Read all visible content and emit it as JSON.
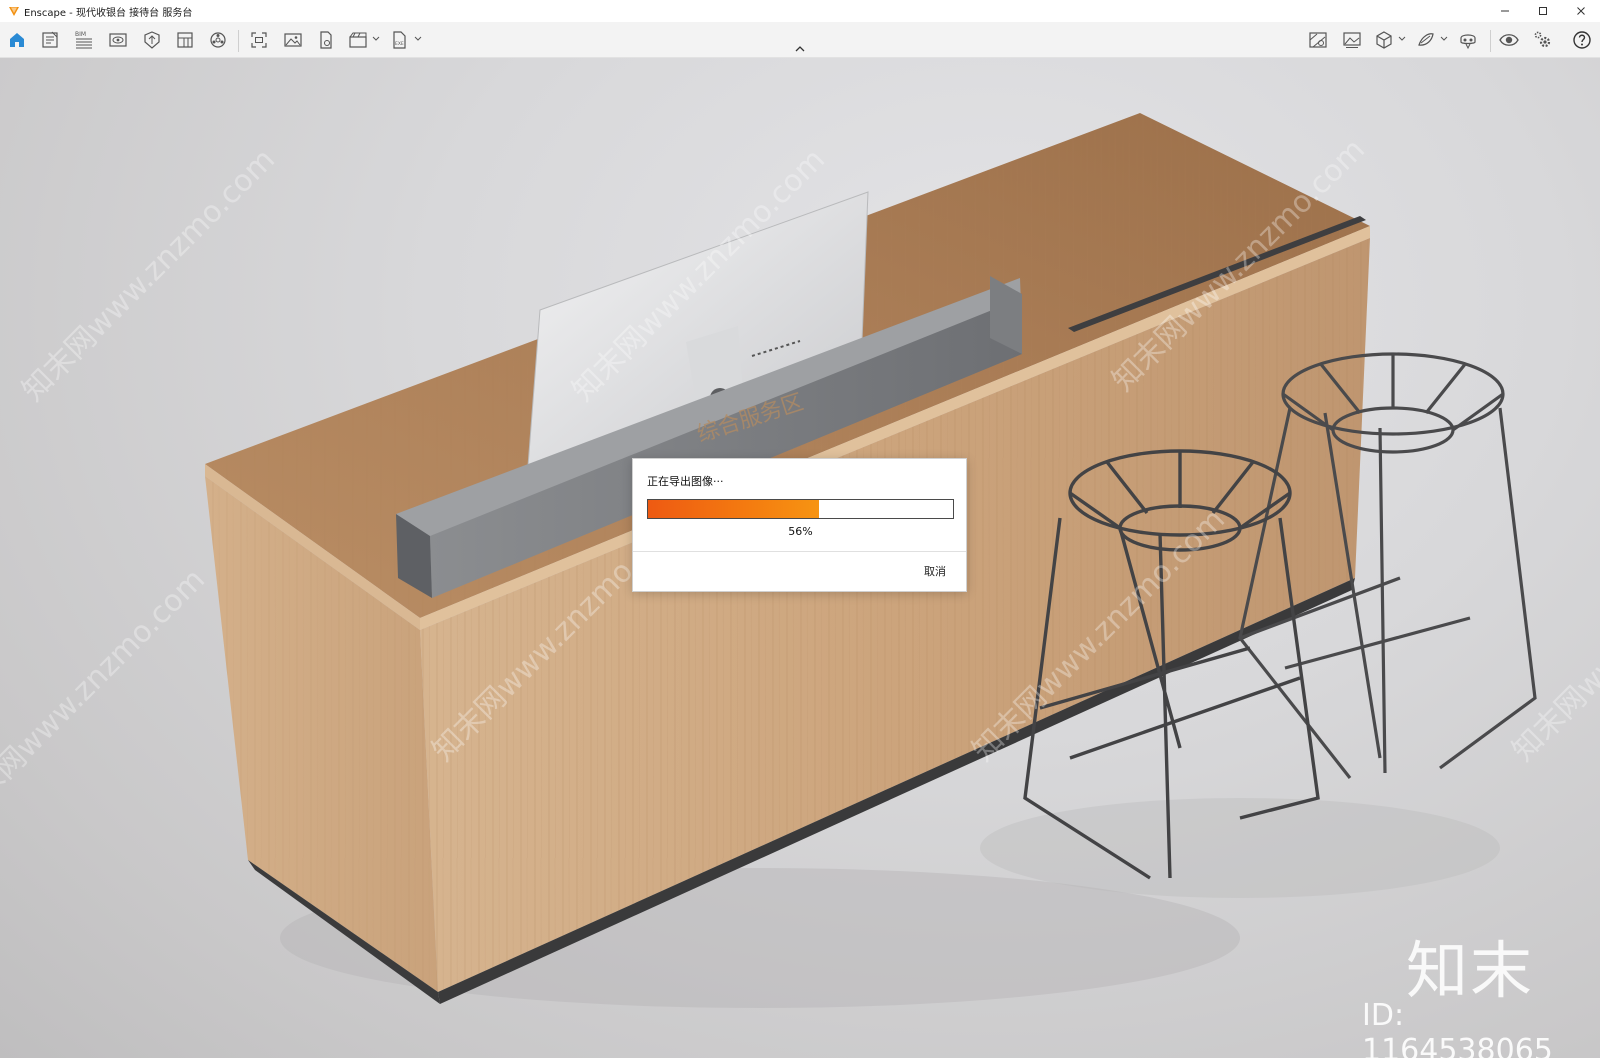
{
  "window": {
    "app_name": "Enscape",
    "title": "Enscape - 现代收银台 接待台 服务台",
    "controls": [
      "minimize-icon",
      "maximize-icon",
      "close-icon"
    ]
  },
  "toolbar": {
    "left_icons": [
      "home-icon",
      "notes-icon",
      "bim-icon",
      "view-icon",
      "asset-library-icon",
      "material-editor-icon",
      "atmosphere-icon",
      "screenshot-icon",
      "image-export-icon",
      "batch-render-icon",
      "video-export-icon",
      "exe-export-icon"
    ],
    "right_icons": [
      "site-context-icon",
      "image-gallery-icon",
      "cube-view-icon",
      "collaboration-icon",
      "vr-headset-icon",
      "visual-settings-icon",
      "settings-icon",
      "help-icon"
    ],
    "active_icon": "home-icon"
  },
  "dialog": {
    "title": "正在导出图像···",
    "progress": 0.56,
    "progress_text": "56%",
    "cancel_label": "取消",
    "progress_color": "#f47c10"
  },
  "watermark": {
    "url_text": "知末网www.znzmo.com",
    "logo_text": "知末",
    "id_text": "ID: 1164538065"
  },
  "colors": {
    "accent": "#2a8ad4",
    "progress": "#f47c10",
    "wood": "#c9a07a"
  }
}
